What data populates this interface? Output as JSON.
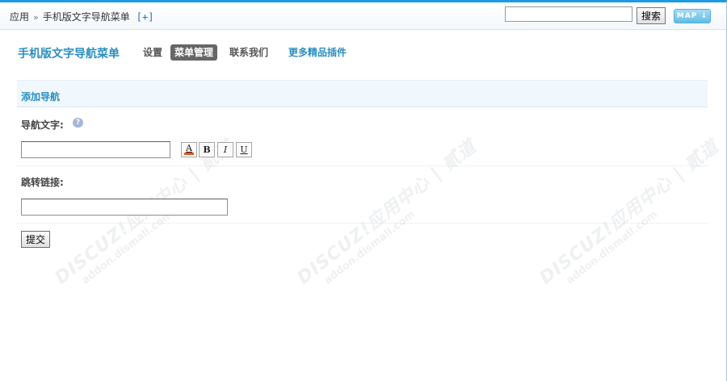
{
  "breadcrumb": {
    "root": "应用",
    "separator": "»",
    "current": "手机版文字导航菜单",
    "add": "[+]"
  },
  "search": {
    "value": "",
    "button": "搜索"
  },
  "map_button": "MAP",
  "plugin_title": "手机版文字导航菜单",
  "nav": {
    "settings": "设置",
    "menu_manage": "菜单管理",
    "contact": "联系我们",
    "more_plugins": "更多精品插件"
  },
  "form": {
    "section_title": "添加导航",
    "nav_text_label": "导航文字:",
    "nav_text_value": "",
    "format_buttons": {
      "color": "A",
      "bold": "B",
      "italic": "I",
      "underline": "U"
    },
    "link_label": "跳转链接:",
    "link_value": "",
    "submit": "提交"
  },
  "watermark": {
    "brand": "DISCUZ!应用中心 | 贰道",
    "domain": "addon.dismall.com"
  },
  "colors": {
    "accent": "#2c8fc0",
    "top_border": "#1d9be0",
    "active_tab": "#666666",
    "color_underline": "#e8561a"
  }
}
